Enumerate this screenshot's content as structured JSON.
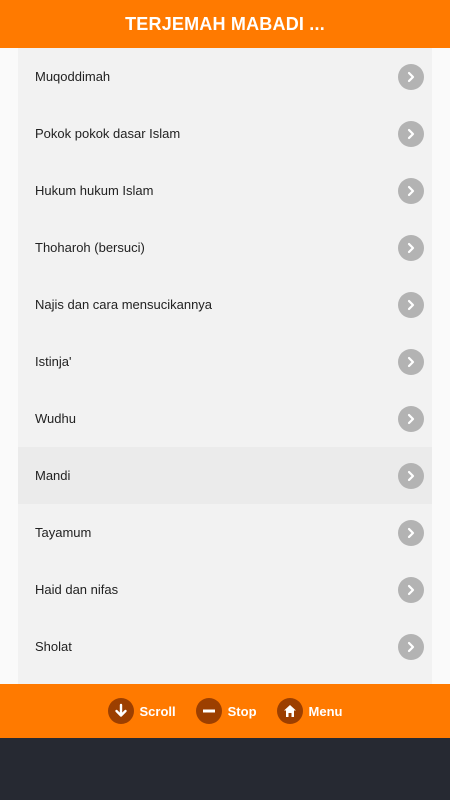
{
  "header": {
    "title": "TERJEMAH MABADI ..."
  },
  "items": [
    {
      "label": "Muqoddimah"
    },
    {
      "label": "Pokok pokok dasar Islam"
    },
    {
      "label": "Hukum hukum Islam"
    },
    {
      "label": "Thoharoh (bersuci)"
    },
    {
      "label": "Najis dan cara mensucikannya"
    },
    {
      "label": "Istinja'"
    },
    {
      "label": "Wudhu"
    },
    {
      "label": "Mandi"
    },
    {
      "label": "Tayamum"
    },
    {
      "label": "Haid dan nifas"
    },
    {
      "label": "Sholat"
    }
  ],
  "toolbar": {
    "scroll_label": "Scroll",
    "stop_label": "Stop",
    "menu_label": "Menu"
  },
  "colors": {
    "accent": "#ff7a00",
    "icon_bg": "#9c3f00",
    "chevron_bg": "#b3b3b3",
    "navbar": "#262932"
  },
  "icons": {
    "item_chevron": "chevron-right-icon",
    "scroll": "arrow-down-icon",
    "stop": "minus-icon",
    "menu": "home-icon"
  }
}
